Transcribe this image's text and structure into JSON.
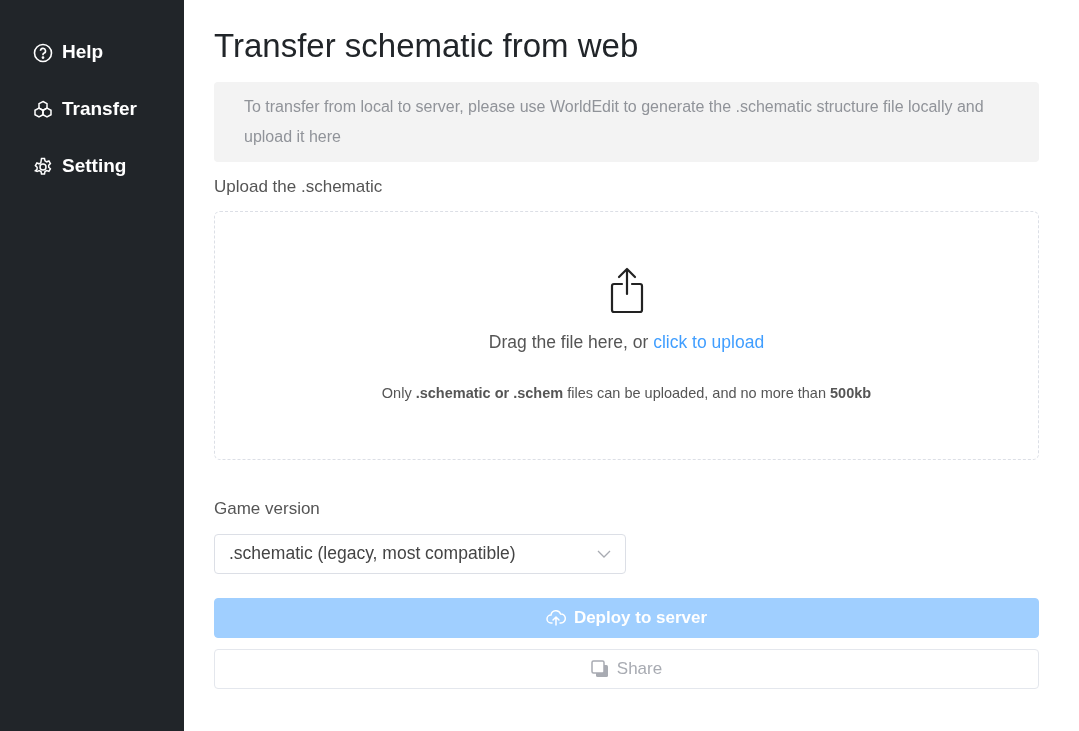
{
  "sidebar": {
    "items": [
      {
        "label": "Help",
        "kind": "help"
      },
      {
        "label": "Transfer",
        "kind": "cubes"
      },
      {
        "label": "Setting",
        "kind": "gear"
      }
    ]
  },
  "title": "Transfer schematic from web",
  "notice": "To transfer from local to server, please use WorldEdit to generate the .schematic structure file locally and upload it here",
  "upload": {
    "label": "Upload the .schematic",
    "prompt": "Drag the file here, or",
    "link": "click to upload",
    "hint": "Only **.schematic or .schem** files can be uploaded, and no more than **500kb**"
  },
  "version": {
    "label": "Game version",
    "value": ".schematic (legacy, most compatible)"
  },
  "buttons": [
    {
      "label": "Deploy to server",
      "kind": "primary",
      "disabled": true
    },
    {
      "label": "Share",
      "kind": "share",
      "disabled": true
    }
  ]
}
